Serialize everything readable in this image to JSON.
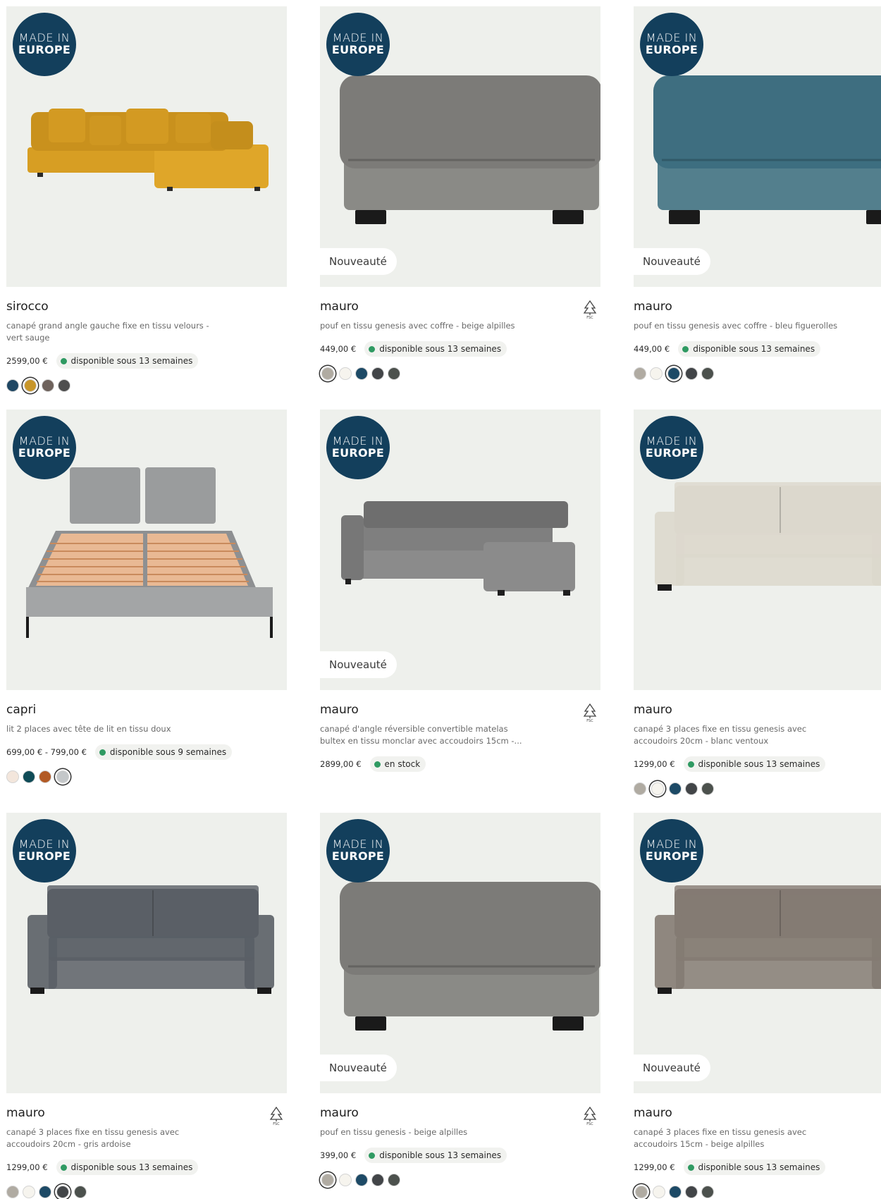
{
  "badges": {
    "made_in": "MADE IN",
    "europe": "EUROPE",
    "new": "Nouveauté"
  },
  "colors": {
    "badge_bg": "#133f5c",
    "availability_dot": "#2f9a62",
    "image_bg": "#eef0ec"
  },
  "icons": {
    "fsc": "fsc-tree-icon"
  },
  "products": [
    {
      "title": "sirocco",
      "description": "canapé grand angle gauche fixe en tissu velours - vert sauge",
      "price": "2599,00 €",
      "availability": "disponible sous 13 semaines",
      "made_in_europe": true,
      "is_new": false,
      "fsc": false,
      "swatches": [
        "#1f4763",
        "#c8962a",
        "#6e625c",
        "#4e4e4e"
      ],
      "selected_swatch": 1
    },
    {
      "title": "mauro",
      "description": "pouf en tissu genesis avec coffre - beige alpilles",
      "price": "449,00 €",
      "availability": "disponible sous 13 semaines",
      "made_in_europe": true,
      "is_new": true,
      "fsc": true,
      "swatches": [
        "#b0aba2",
        "#f6f4ee",
        "#1d4a66",
        "#424548",
        "#4c514d"
      ],
      "selected_swatch": 0
    },
    {
      "title": "mauro",
      "description": "pouf en tissu genesis avec coffre - bleu figuerolles",
      "price": "449,00 €",
      "availability": "disponible sous 13 semaines",
      "made_in_europe": true,
      "is_new": true,
      "fsc": false,
      "swatches": [
        "#b0aba2",
        "#f6f4ee",
        "#1d4a66",
        "#424548",
        "#4c514d"
      ],
      "selected_swatch": 2
    },
    {
      "title": "capri",
      "description": "lit 2 places avec tête de lit en tissu doux",
      "price": "699,00 € - 799,00 €",
      "availability": "disponible sous 9 semaines",
      "made_in_europe": true,
      "is_new": false,
      "fsc": false,
      "swatches": [
        "#f3e6dc",
        "#0f4b57",
        "#b25a25",
        "#c4c7c9"
      ],
      "selected_swatch": 3
    },
    {
      "title": "mauro",
      "description": "canapé d'angle réversible convertible matelas bultex en tissu monclar avec accoudoirs 15cm -...",
      "price": "2899,00 €",
      "availability": "en stock",
      "made_in_europe": true,
      "is_new": true,
      "fsc": true,
      "swatches": [],
      "selected_swatch": -1
    },
    {
      "title": "mauro",
      "description": "canapé 3 places fixe en tissu genesis avec accoudoirs 20cm - blanc ventoux",
      "price": "1299,00 €",
      "availability": "disponible sous 13 semaines",
      "made_in_europe": true,
      "is_new": false,
      "fsc": false,
      "swatches": [
        "#b0aba2",
        "#f6f4ee",
        "#1d4a66",
        "#424548",
        "#4c514d"
      ],
      "selected_swatch": 1
    },
    {
      "title": "mauro",
      "description": "canapé 3 places fixe en tissu genesis avec accoudoirs 20cm - gris ardoise",
      "price": "1299,00 €",
      "availability": "disponible sous 13 semaines",
      "made_in_europe": true,
      "is_new": false,
      "fsc": true,
      "swatches": [
        "#b0aba2",
        "#f6f4ee",
        "#1d4a66",
        "#424548",
        "#4c514d"
      ],
      "selected_swatch": 3
    },
    {
      "title": "mauro",
      "description": "pouf en tissu genesis - beige alpilles",
      "price": "399,00 €",
      "availability": "disponible sous 13 semaines",
      "made_in_europe": true,
      "is_new": true,
      "fsc": true,
      "swatches": [
        "#b0aba2",
        "#f6f4ee",
        "#1d4a66",
        "#424548",
        "#4c514d"
      ],
      "selected_swatch": 0
    },
    {
      "title": "mauro",
      "description": "canapé 3 places fixe en tissu genesis avec accoudoirs 15cm - beige alpilles",
      "price": "1299,00 €",
      "availability": "disponible sous 13 semaines",
      "made_in_europe": true,
      "is_new": true,
      "fsc": false,
      "swatches": [
        "#b0aba2",
        "#f6f4ee",
        "#1d4a66",
        "#424548",
        "#4c514d"
      ],
      "selected_swatch": 0
    }
  ]
}
